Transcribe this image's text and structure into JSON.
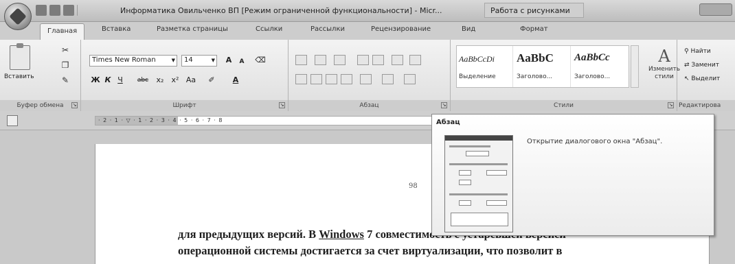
{
  "titlebar": {
    "title": "Информатика Овильченко ВП [Режим ограниченной функциональности] - Micr...",
    "context_tab": "Работа с рисунками"
  },
  "tabs": [
    "Главная",
    "Вставка",
    "Разметка страницы",
    "Ссылки",
    "Рассылки",
    "Рецензирование",
    "Вид",
    "Формат"
  ],
  "clipboard": {
    "paste_label": "Вставить",
    "group_label": "Буфер обмена"
  },
  "font": {
    "name": "Times New Roman",
    "size": "14",
    "grow": "A",
    "shrink": "A",
    "bold": "Ж",
    "italic": "К",
    "underline": "Ч",
    "strike": "abc",
    "subscript": "x₂",
    "superscript": "x²",
    "change_case": "Aa",
    "font_color": "A",
    "group_label": "Шрифт"
  },
  "paragraph": {
    "group_label": "Абзац"
  },
  "styles": {
    "items": [
      {
        "sample": "AaBbCcDi",
        "name": "Выделение"
      },
      {
        "sample": "AaBbC",
        "name": "Заголово..."
      },
      {
        "sample": "AaBbCc",
        "name": "Заголово..."
      }
    ],
    "change_label": "Изменить стили",
    "group_label": "Стили"
  },
  "editing": {
    "find": "Найти",
    "replace": "Заменит",
    "select": "Выделит",
    "group_label": "Редактирова"
  },
  "ruler": {
    "numbers": "· 2 · 1 · ▽ · 1 · 2 · 3 · 4 · 5 · 6 · 7 · 8"
  },
  "document": {
    "page_number": "98",
    "line1_a": "для предыдущих версий. В ",
    "line1_link": "Windows",
    "line1_b": " 7 совместимость с устаревшей версией",
    "line2": "операционной системы достигается за счет виртуализации, что позволит в"
  },
  "tooltip": {
    "title": "Абзац",
    "description": "Открытие диалогового окна \"Абзац\"."
  }
}
